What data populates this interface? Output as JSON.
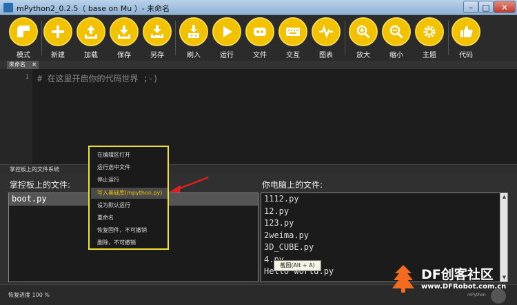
{
  "window": {
    "title": "mPython2_0.2.5（ base on Mu ）- 未命名"
  },
  "toolbar": {
    "buttons": [
      {
        "icon": "mode-icon",
        "label": "模式"
      },
      {
        "icon": "plus-icon",
        "label": "新建"
      },
      {
        "icon": "upload-icon",
        "label": "加载"
      },
      {
        "icon": "save-icon",
        "label": "保存"
      },
      {
        "icon": "save-as-icon",
        "label": "另存"
      },
      {
        "icon": "flash-icon",
        "label": "刷入"
      },
      {
        "icon": "play-icon",
        "label": "运行"
      },
      {
        "icon": "files-icon",
        "label": "文件"
      },
      {
        "icon": "keyboard-icon",
        "label": "交互"
      },
      {
        "icon": "pulse-icon",
        "label": "图表"
      },
      {
        "icon": "zoom-in-icon",
        "label": "放大"
      },
      {
        "icon": "zoom-out-icon",
        "label": "缩小"
      },
      {
        "icon": "gear-icon",
        "label": "主题"
      },
      {
        "icon": "thumbs-up-icon",
        "label": "代码"
      }
    ]
  },
  "tabs": [
    {
      "label": "未命名",
      "close": "✖"
    }
  ],
  "editor": {
    "lines": [
      {
        "number": "1",
        "text": "# 在这里开启你的代码世界 ;-)"
      }
    ]
  },
  "filesystem": {
    "header": "掌控板上的文件系统",
    "device_title": "掌控板上的文件:",
    "computer_title": "你电脑上的文件:",
    "device_files": [
      "boot.py"
    ],
    "computer_files": [
      "1112.py",
      "12.py",
      "123.py",
      "2weima.py",
      "3D_CUBE.py",
      "4.py",
      "Hello world.py"
    ]
  },
  "context_menu": {
    "items": [
      {
        "label": "在编辑区打开"
      },
      {
        "label": "运行选中文件"
      },
      {
        "label": "停止运行"
      },
      {
        "label": "写入基础库(mpython.py)",
        "active": true
      },
      {
        "label": "设为默认运行"
      },
      {
        "label": "重命名"
      },
      {
        "label": "恢复固件，不可撤销"
      },
      {
        "label": "删除，不可撤销"
      }
    ]
  },
  "tooltip": "截图(Alt + A)",
  "status": {
    "text": "恢复进度 100 %",
    "mode": "mPython"
  },
  "watermark": {
    "brand": "DF创客社区",
    "url": "www.DFRobot.com.cn"
  },
  "colors": {
    "accent": "#f2c200",
    "highlight_border": "#f2e233",
    "arrow": "#e02020"
  }
}
